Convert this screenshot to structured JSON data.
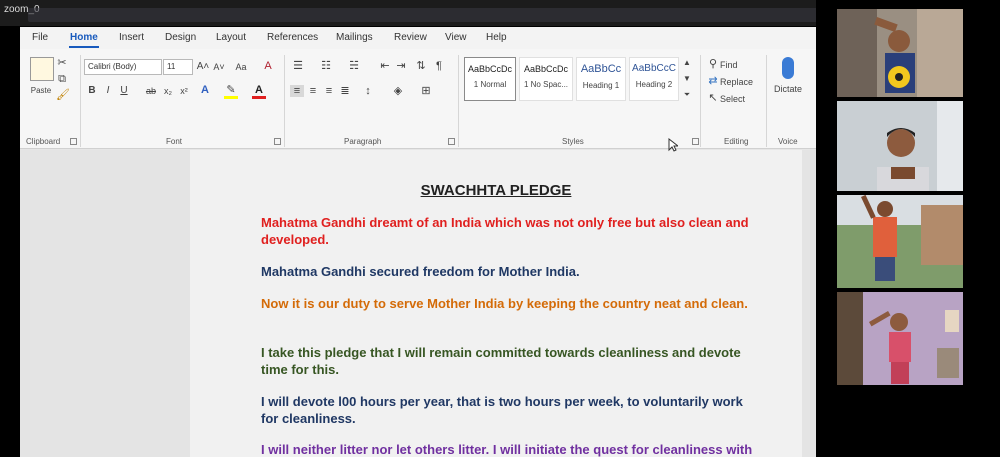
{
  "window": {
    "title": "zoom_0"
  },
  "ribbon_tabs": [
    "File",
    "Home",
    "Insert",
    "Design",
    "Layout",
    "References",
    "Mailings",
    "Review",
    "View",
    "Help"
  ],
  "active_tab": "Home",
  "clipboard": {
    "paste_label": "Paste",
    "group_label": "Clipboard"
  },
  "font": {
    "name": "Calibri (Body)",
    "size": "11",
    "group_label": "Font",
    "case_label": "Aa"
  },
  "paragraph": {
    "group_label": "Paragraph"
  },
  "styles": {
    "group_label": "Styles",
    "items": [
      {
        "sample": "AaBbCcDc",
        "name": "1 Normal"
      },
      {
        "sample": "AaBbCcDc",
        "name": "1 No Spac..."
      },
      {
        "sample": "AaBbCc",
        "name": "Heading 1"
      },
      {
        "sample": "AaBbCcC",
        "name": "Heading 2"
      }
    ]
  },
  "editing": {
    "find_label": "Find",
    "replace_label": "Replace",
    "select_label": "Select",
    "group_label": "Editing"
  },
  "voice": {
    "dictate_label": "Dictate",
    "group_label": "Voice"
  },
  "document": {
    "title": "SWACHHTA PLEDGE",
    "paragraphs": [
      {
        "text": "Mahatma Gandhi dreamt of an India which was not only free but also clean and developed.",
        "color": "#e0201f"
      },
      {
        "text": "Mahatma Gandhi secured freedom for Mother India.",
        "color": "#1f3864"
      },
      {
        "text": "Now it is our duty to serve Mother India by keeping the country neat and clean.",
        "color": "#d46b08"
      },
      {
        "text": "I take this pledge that I will remain committed towards cleanliness and devote time for this.",
        "color": "#375623"
      },
      {
        "text": "I will devote l00 hours per year, that is two hours per week, to voluntarily work for cleanliness.",
        "color": "#203864"
      },
      {
        "text": "I will neither litter nor let others litter. I will initiate the quest for cleanliness with myself, my family, my locality, my village and my work place.",
        "color": "#7030a0"
      }
    ]
  },
  "colors": {
    "accent": "#185abd",
    "zoom_bar": "#1c1c1c"
  },
  "participant_tiles": [
    {
      "scene": "child-with-ball",
      "bg": "#9a8f82"
    },
    {
      "scene": "child-at-desk",
      "bg": "#c9cfd3"
    },
    {
      "scene": "child-outdoors",
      "bg": "#9fb38f"
    },
    {
      "scene": "child-in-room",
      "bg": "#8a7a9a"
    }
  ]
}
